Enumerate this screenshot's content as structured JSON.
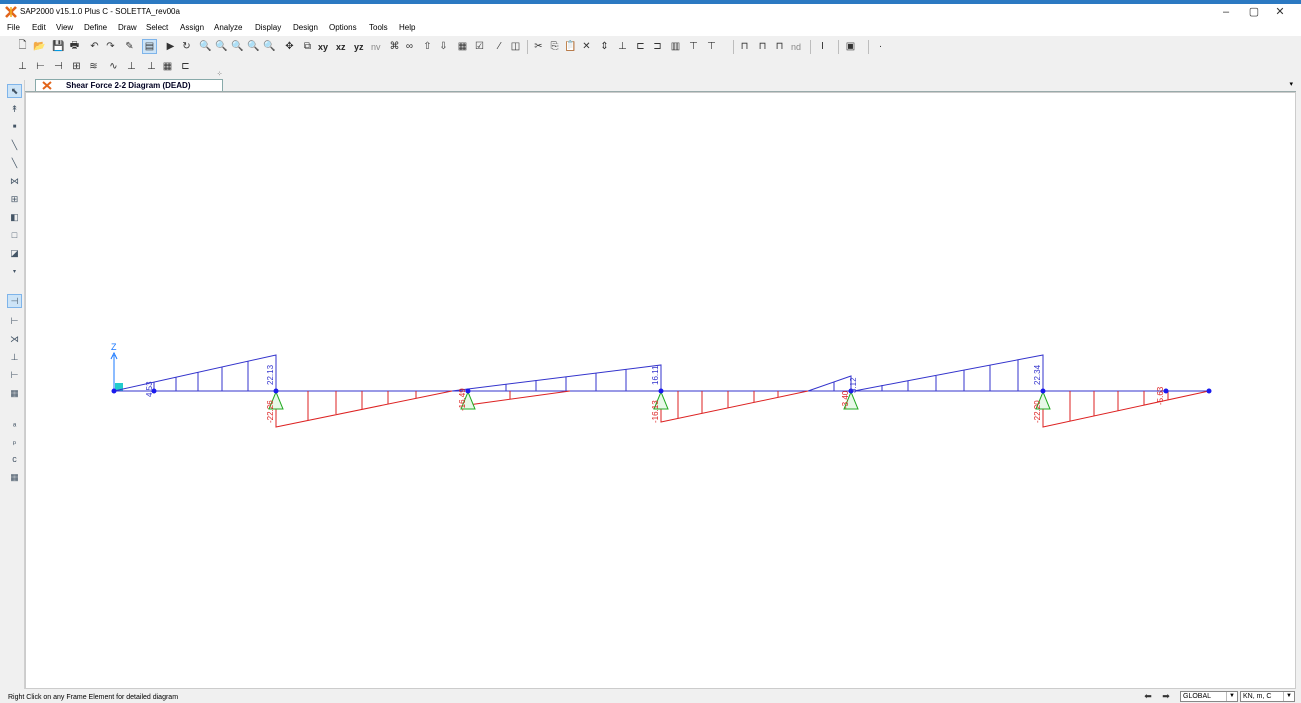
{
  "window": {
    "title": "SAP2000 v15.1.0 Plus C  - SOLETTA_rev00a",
    "controls": [
      "–",
      "▢",
      "✕"
    ]
  },
  "menu": [
    "File",
    "Edit",
    "View",
    "Define",
    "Draw",
    "Select",
    "Assign",
    "Analyze",
    "Display",
    "Design",
    "Options",
    "Tools",
    "Help"
  ],
  "toolbar": {
    "view_xy": "xy",
    "view_xz": "xz",
    "view_yz": "yz",
    "view_nv": "nv",
    "nd": "nd"
  },
  "tab": {
    "label": "Shear Force 2-2 Diagram  (DEAD)"
  },
  "diagram": {
    "axis_label": "Z",
    "blue_color": "#3333cc",
    "red_color": "#dd2222",
    "support_color": "#22aa22",
    "node_color": "#1a1aee",
    "value_labels": [
      "4.53",
      "22.13",
      "-22.26",
      "-16.49",
      "-16.13",
      "16.11",
      "-3.40",
      "3.12",
      "22.34",
      "-22.20",
      "-5.63"
    ]
  },
  "status": {
    "message": "Right Click on any Frame Element for detailed diagram",
    "coord_system": "GLOBAL",
    "units": "KN, m, C"
  }
}
